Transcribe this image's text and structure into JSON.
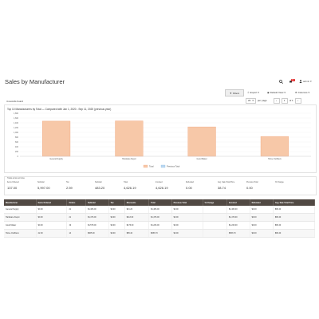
{
  "page": {
    "title": "Sales by Manufacturer"
  },
  "header_actions": {
    "search_icon": "search-icon",
    "notifications_count": "11",
    "user_label": "admin"
  },
  "toolbar": {
    "filters_label": "Filters",
    "export_label": "Export",
    "default_view_label": "Default View",
    "columns_label": "Columns"
  },
  "records": {
    "found_label": "4 records found"
  },
  "pager": {
    "per_page_value": "20",
    "per_page_label": "per page",
    "current_page": "1",
    "page_of": "of 1"
  },
  "chart_data": {
    "type": "bar",
    "title": "Top 10 Manufacturers by Total — Compared with Jan 1, 2020 - Sep 11, 2020 (previous year)",
    "categories": [
      "General Supply",
      "Hardware Depot",
      "Good Maker",
      "Home Outfitters"
    ],
    "y_ticks": [
      "1,800",
      "1,600",
      "1,400",
      "1,200",
      "1,000",
      "800",
      "600",
      "400",
      "200",
      "0"
    ],
    "ylim": [
      0,
      1800
    ],
    "series": [
      {
        "name": "Total",
        "values": [
          1470,
          1480,
          1230,
          830
        ],
        "color": "#f7c8a8"
      },
      {
        "name": "Previous Total",
        "values": [
          0,
          0,
          0,
          0
        ],
        "color": "#bcd9f2"
      }
    ],
    "legend_position": "bottom-center"
  },
  "totals": {
    "heading": "Totals across all rows",
    "items": [
      {
        "label": "Items Ordered",
        "value": "137.00"
      },
      {
        "label": "Subtotal",
        "value": "5,997.00"
      },
      {
        "label": "Tax",
        "value": "2.59"
      },
      {
        "label": "Subtotal",
        "value": "483.20"
      },
      {
        "label": "Total",
        "value": "4,626.19"
      },
      {
        "label": "Invoiced",
        "value": "4,626.19"
      },
      {
        "label": "Refunded",
        "value": "0.00"
      },
      {
        "label": "Avg. Sale Total Price",
        "value": "38.74"
      },
      {
        "label": "Previous Total",
        "value": "0.00"
      },
      {
        "label": "% Change",
        "value": ""
      }
    ]
  },
  "grid": {
    "columns": [
      "Manufacturer",
      "Items Ordered",
      "Orders",
      "Subtotal",
      "Tax",
      "Discounts",
      "Total",
      "Previous Total",
      "% Change",
      "Invoiced",
      "Refunded",
      "Avg. Sale Total Price"
    ],
    "rows": [
      [
        "General Supply",
        "$0.00",
        "21",
        "$1,466.00",
        "$0.00",
        "$21.20",
        "$1,466.00",
        "$0.00",
        "",
        "$1,466.00",
        "$0.00",
        "$86.40"
      ],
      [
        "Hardware Depot",
        "$0.00",
        "21",
        "$1,476.00",
        "$0.00",
        "$113.00",
        "$1,476.00",
        "$0.00",
        "",
        "$1,476.00",
        "$0.00",
        "$86.40"
      ],
      [
        "Good Maker",
        "$0.00",
        "19",
        "$1,578.00",
        "$0.00",
        "$176.00",
        "$1,226.00",
        "$0.00",
        "",
        "$1,226.00",
        "$0.00",
        "$86.40"
      ],
      [
        "Home Outfitters",
        "22.00",
        "14",
        "$665.00",
        "$0.00",
        "$65.40",
        "$653.70",
        "$0.00",
        "",
        "$653.70",
        "$0.00",
        "$86.40"
      ]
    ]
  }
}
